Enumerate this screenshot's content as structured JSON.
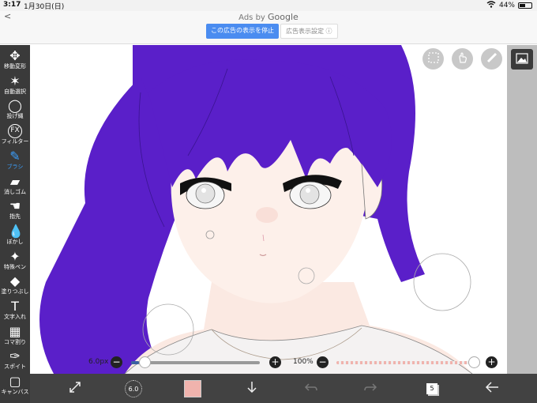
{
  "status": {
    "time": "3:17",
    "date": "1月30日(日)",
    "battery": "44%"
  },
  "ad": {
    "back": "<",
    "ads_by": "Ads by ",
    "google": "Google",
    "stop_label": "この広告の表示を停止",
    "settings_label": "広告表示設定 ⓘ"
  },
  "toolbar": [
    {
      "label": "移動変形",
      "icon": "move-icon",
      "glyph": "✥"
    },
    {
      "label": "自動選択",
      "icon": "magic-wand-icon",
      "glyph": "✶"
    },
    {
      "label": "投げ縄",
      "icon": "lasso-icon",
      "glyph": "◯"
    },
    {
      "label": "フィルター",
      "icon": "filter-fx-icon",
      "glyph": "FX"
    },
    {
      "label": "ブラシ",
      "icon": "brush-icon",
      "glyph": "✎"
    },
    {
      "label": "消しゴム",
      "icon": "eraser-icon",
      "glyph": "▰"
    },
    {
      "label": "指先",
      "icon": "finger-smudge-icon",
      "glyph": "☚"
    },
    {
      "label": "ぼかし",
      "icon": "blur-drop-icon",
      "glyph": "💧"
    },
    {
      "label": "特殊ペン",
      "icon": "special-pen-icon",
      "glyph": "✦"
    },
    {
      "label": "塗りつぶし",
      "icon": "fill-bucket-icon",
      "glyph": "◆"
    },
    {
      "label": "文字入れ",
      "icon": "text-icon",
      "glyph": "T"
    },
    {
      "label": "コマ割り",
      "icon": "frame-divider-icon",
      "glyph": "▦"
    },
    {
      "label": "スポイト",
      "icon": "eyedropper-icon",
      "glyph": "✑"
    },
    {
      "label": "キャンバス",
      "icon": "canvas-icon",
      "glyph": "▢"
    }
  ],
  "active_tool": "ブラシ",
  "brush": {
    "size_label": "6.0px",
    "size_fraction": 0.03,
    "opacity_label": "100%",
    "opacity_fraction": 1.0,
    "indicator": "6.0"
  },
  "layers": {
    "count": "5"
  },
  "colors": {
    "accent": "#3ba0ff",
    "current_color": "#f0b3ad",
    "hair": "#5a1fc9",
    "toolbar_bg": "#3a3a3a"
  }
}
